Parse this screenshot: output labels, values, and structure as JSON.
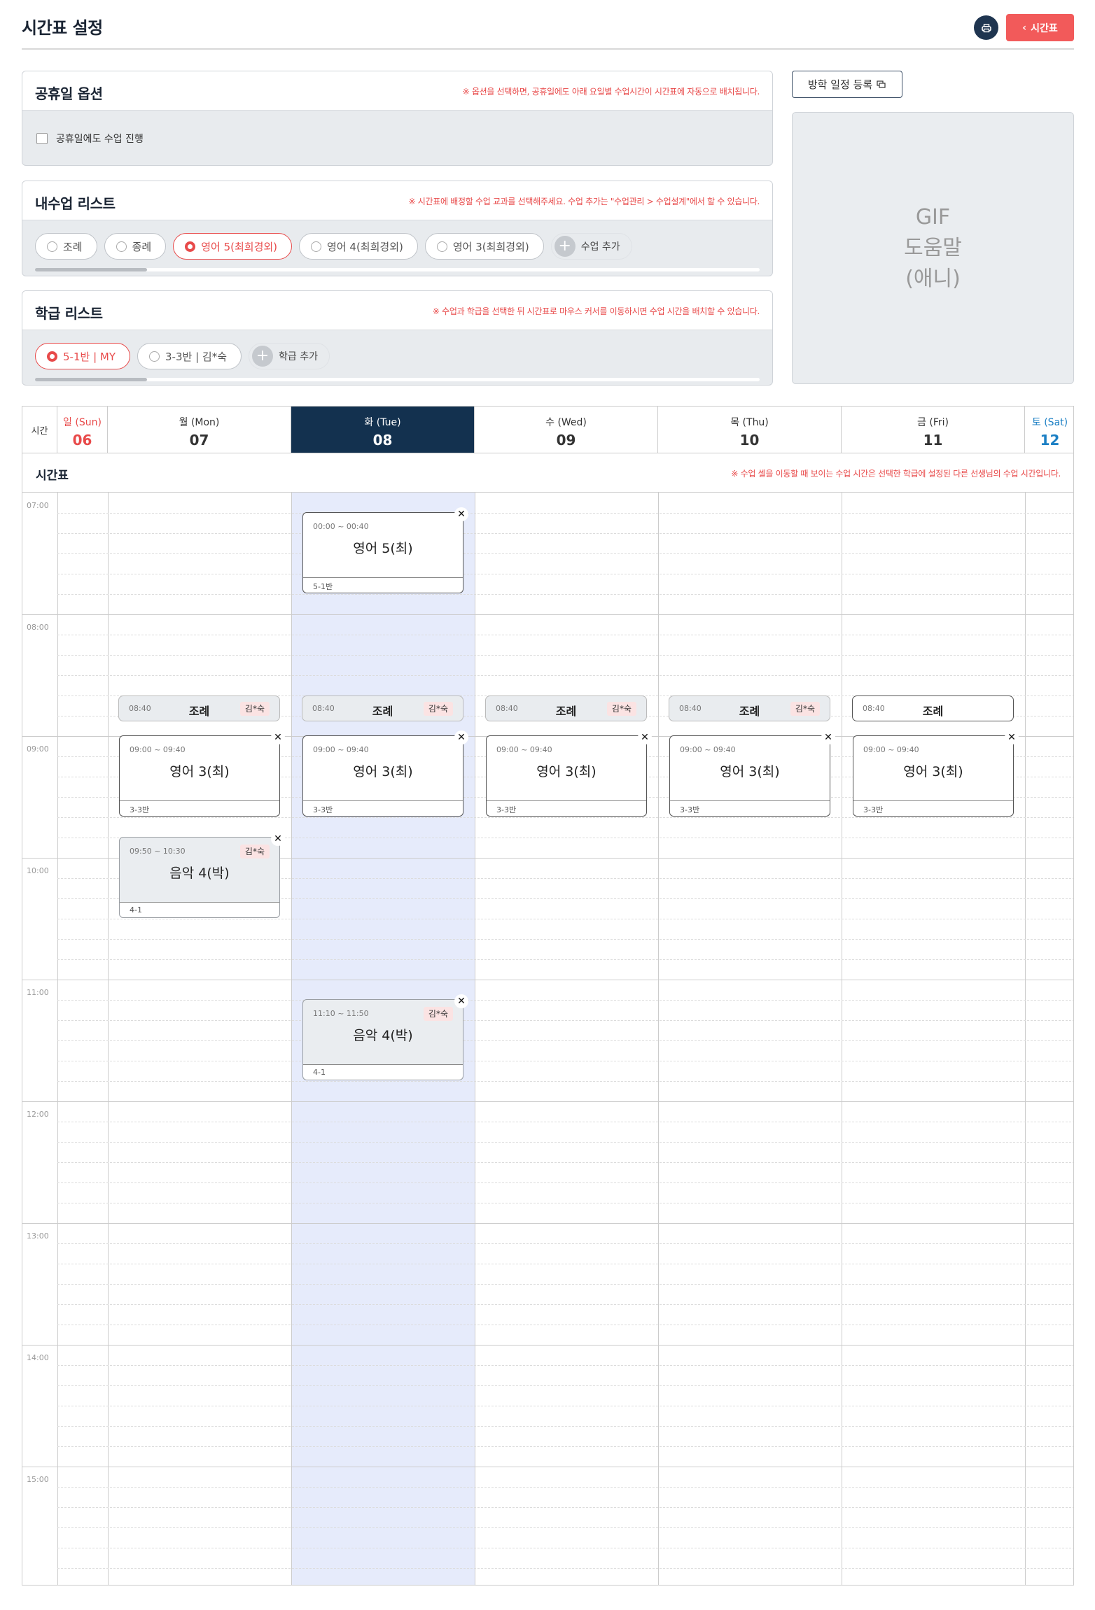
{
  "header": {
    "title": "시간표 설정",
    "back_label": "시간표"
  },
  "holiday_panel": {
    "title": "공휴일 옵션",
    "note": "※ 옵션을 선택하면, 공휴일에도 아래 요일별 수업시간이 시간표에 자동으로 배치됩니다.",
    "checkbox_label": "공휴일에도 수업 진행"
  },
  "class_panel": {
    "title": "내수업 리스트",
    "note": "※ 시간표에 배정할 수업 교과를 선택해주세요. 수업 추가는 \"수업관리 > 수업설계\"에서 할 수 있습니다.",
    "chips": [
      "조례",
      "종례",
      "영어 5(최희경외)",
      "영어 4(최희경외)",
      "영어 3(최희경외)"
    ],
    "add_label": "수업 추가"
  },
  "grade_panel": {
    "title": "학급 리스트",
    "note": "※ 수업과 학급을 선택한 뒤 시간표로 마우스 커서를 이동하시면 수업 시간을 배치할 수 있습니다.",
    "chips": [
      "5-1반 | MY",
      "3-3반 | 김*숙"
    ],
    "add_label": "학급 추가"
  },
  "side": {
    "vacation_button": "방학 일정 등록",
    "gif_lines": [
      "GIF",
      "도움말",
      "(애니)"
    ]
  },
  "calendar": {
    "time_label": "시간",
    "days": [
      {
        "name": "일 (Sun)",
        "num": "06"
      },
      {
        "name": "월 (Mon)",
        "num": "07"
      },
      {
        "name": "화 (Tue)",
        "num": "08"
      },
      {
        "name": "수 (Wed)",
        "num": "09"
      },
      {
        "name": "목 (Thu)",
        "num": "10"
      },
      {
        "name": "금 (Fri)",
        "num": "11"
      },
      {
        "name": "토 (Sat)",
        "num": "12"
      }
    ],
    "timetable_title": "시간표",
    "timetable_note": "※ 수업 셀을 이동할 때 보이는 수업 시간은 선택한 학급에 설정된 다른 선생님의 수업 시간입니다.",
    "hours": [
      "07:00",
      "08:00",
      "09:00",
      "10:00",
      "11:00",
      "12:00",
      "13:00",
      "14:00",
      "15:00"
    ],
    "events": {
      "tue_eng5": {
        "time": "00:00 ~ 00:40",
        "title": "영어 5(최)",
        "class": "5-1반"
      },
      "mon_jorye": {
        "time": "08:40",
        "title": "조례",
        "teacher": "김*숙"
      },
      "tue_jorye": {
        "time": "08:40",
        "title": "조례",
        "teacher": "김*숙"
      },
      "wed_jorye": {
        "time": "08:40",
        "title": "조례",
        "teacher": "김*숙"
      },
      "thu_jorye": {
        "time": "08:40",
        "title": "조례",
        "teacher": "김*숙"
      },
      "fri_jorye": {
        "time": "08:40",
        "title": "조례"
      },
      "mon_eng3": {
        "time": "09:00 ~ 09:40",
        "title": "영어 3(최)",
        "class": "3-3반"
      },
      "tue_eng3": {
        "time": "09:00 ~ 09:40",
        "title": "영어 3(최)",
        "class": "3-3반"
      },
      "wed_eng3": {
        "time": "09:00 ~ 09:40",
        "title": "영어 3(최)",
        "class": "3-3반"
      },
      "thu_eng3": {
        "time": "09:00 ~ 09:40",
        "title": "영어 3(최)",
        "class": "3-3반"
      },
      "fri_eng3": {
        "time": "09:00 ~ 09:40",
        "title": "영어 3(최)",
        "class": "3-3반"
      },
      "mon_music": {
        "time": "09:50 ~ 10:30",
        "title": "음악 4(박)",
        "class": "4-1",
        "teacher": "김*숙"
      },
      "tue_music": {
        "time": "11:10 ~ 11:50",
        "title": "음악 4(박)",
        "class": "4-1",
        "teacher": "김*숙"
      }
    }
  },
  "colors": {
    "accent": "#e84a4a",
    "today": "#13314f",
    "saturday": "#1b7fc4",
    "highlight_col": "#e6ebfb"
  }
}
